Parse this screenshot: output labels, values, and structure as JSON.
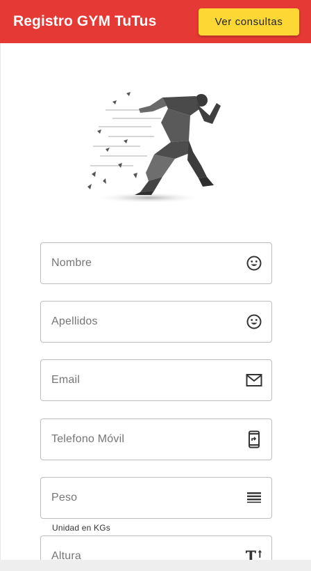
{
  "header": {
    "title": "Registro GYM TuTus",
    "consult_button": "Ver consultas"
  },
  "colors": {
    "app_bar": "#e53935",
    "button": "#fdd835"
  },
  "hero": {
    "icon": "runner-illustration"
  },
  "form": {
    "fields": [
      {
        "placeholder": "Nombre",
        "icon": "smiley-icon"
      },
      {
        "placeholder": "Apellidos",
        "icon": "smiley-icon"
      },
      {
        "placeholder": "Email",
        "icon": "mail-icon"
      },
      {
        "placeholder": "Telefono Móvil",
        "icon": "phone-icon"
      },
      {
        "placeholder": "Peso",
        "icon": "weight-lines-icon",
        "hint": "Unidad en KGs"
      },
      {
        "placeholder": "Altura",
        "icon": "text-height-icon"
      }
    ]
  }
}
